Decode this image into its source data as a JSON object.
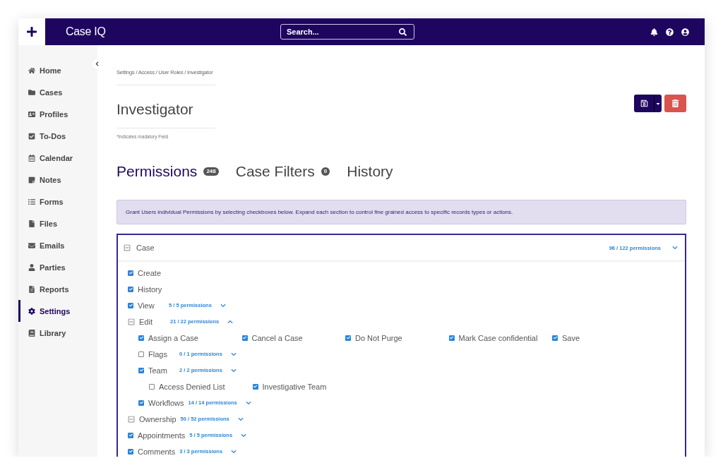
{
  "header": {
    "brand": "Case IQ",
    "search": {
      "placeholder": "Search..."
    }
  },
  "sidebar": {
    "items": [
      {
        "label": "Home",
        "selected": false
      },
      {
        "label": "Cases",
        "selected": false
      },
      {
        "label": "Profiles",
        "selected": false
      },
      {
        "label": "To-Dos",
        "selected": false
      },
      {
        "label": "Calendar",
        "selected": false
      },
      {
        "label": "Notes",
        "selected": false
      },
      {
        "label": "Forms",
        "selected": false
      },
      {
        "label": "Files",
        "selected": false
      },
      {
        "label": "Emails",
        "selected": false
      },
      {
        "label": "Parties",
        "selected": false
      },
      {
        "label": "Reports",
        "selected": false
      },
      {
        "label": "Settings",
        "selected": true
      },
      {
        "label": "Library",
        "selected": false
      }
    ]
  },
  "breadcrumb": "Settings / Access / User Roles / Investigator",
  "title": "Investigator",
  "note": "*Indicates madatory Field",
  "tabs": [
    {
      "label": "Permissions",
      "badge": "248",
      "selected": true
    },
    {
      "label": "Case Filters",
      "badge": "0",
      "selected": false
    },
    {
      "label": "History",
      "selected": false
    }
  ],
  "info": "Grant Users individual Permissions by selecting checkboxes below. Expand each section to control fine grained access to specific records types or actions.",
  "section": {
    "label": "Case",
    "count": "96 / 122 permissions",
    "expanded": false,
    "children": [
      {
        "label": "Create",
        "kind": "checkbox",
        "checked": true
      },
      {
        "label": "History",
        "kind": "checkbox",
        "checked": true
      },
      {
        "label": "View",
        "kind": "checkbox",
        "checked": true,
        "count": "5 / 5 permissions",
        "expanded": false
      },
      {
        "label": "Edit",
        "kind": "partial",
        "count": "21 / 22 permissions",
        "expanded": true,
        "options": [
          {
            "label": "Assign a Case",
            "checked": true
          },
          {
            "label": "Cancel a Case",
            "checked": true
          },
          {
            "label": "Do Not Purge",
            "checked": true
          },
          {
            "label": "Mark Case confidential",
            "checked": true
          },
          {
            "label": "Save",
            "checked": true
          }
        ],
        "children": [
          {
            "label": "Flags",
            "kind": "checkbox",
            "checked": false,
            "count": "0 / 1 permissions",
            "expanded": false
          },
          {
            "label": "Team",
            "kind": "checkbox",
            "checked": true,
            "count": "2 / 2 permissions",
            "expanded": false,
            "options": [
              {
                "label": "Access Denied List",
                "checked": false
              },
              {
                "label": "Investigative Team",
                "checked": true
              }
            ]
          },
          {
            "label": "Workflows",
            "kind": "checkbox",
            "checked": true,
            "count": "14 / 14 permissions",
            "expanded": false
          }
        ]
      },
      {
        "label": "Ownership",
        "kind": "partial",
        "count": "50 / 52 permissions",
        "expanded": false
      },
      {
        "label": "Appointments",
        "kind": "checkbox",
        "checked": true,
        "count": "5 / 5 permissions",
        "expanded": false
      },
      {
        "label": "Comments",
        "kind": "checkbox",
        "checked": true,
        "count": "3 / 3 permissions",
        "expanded": false
      }
    ]
  }
}
